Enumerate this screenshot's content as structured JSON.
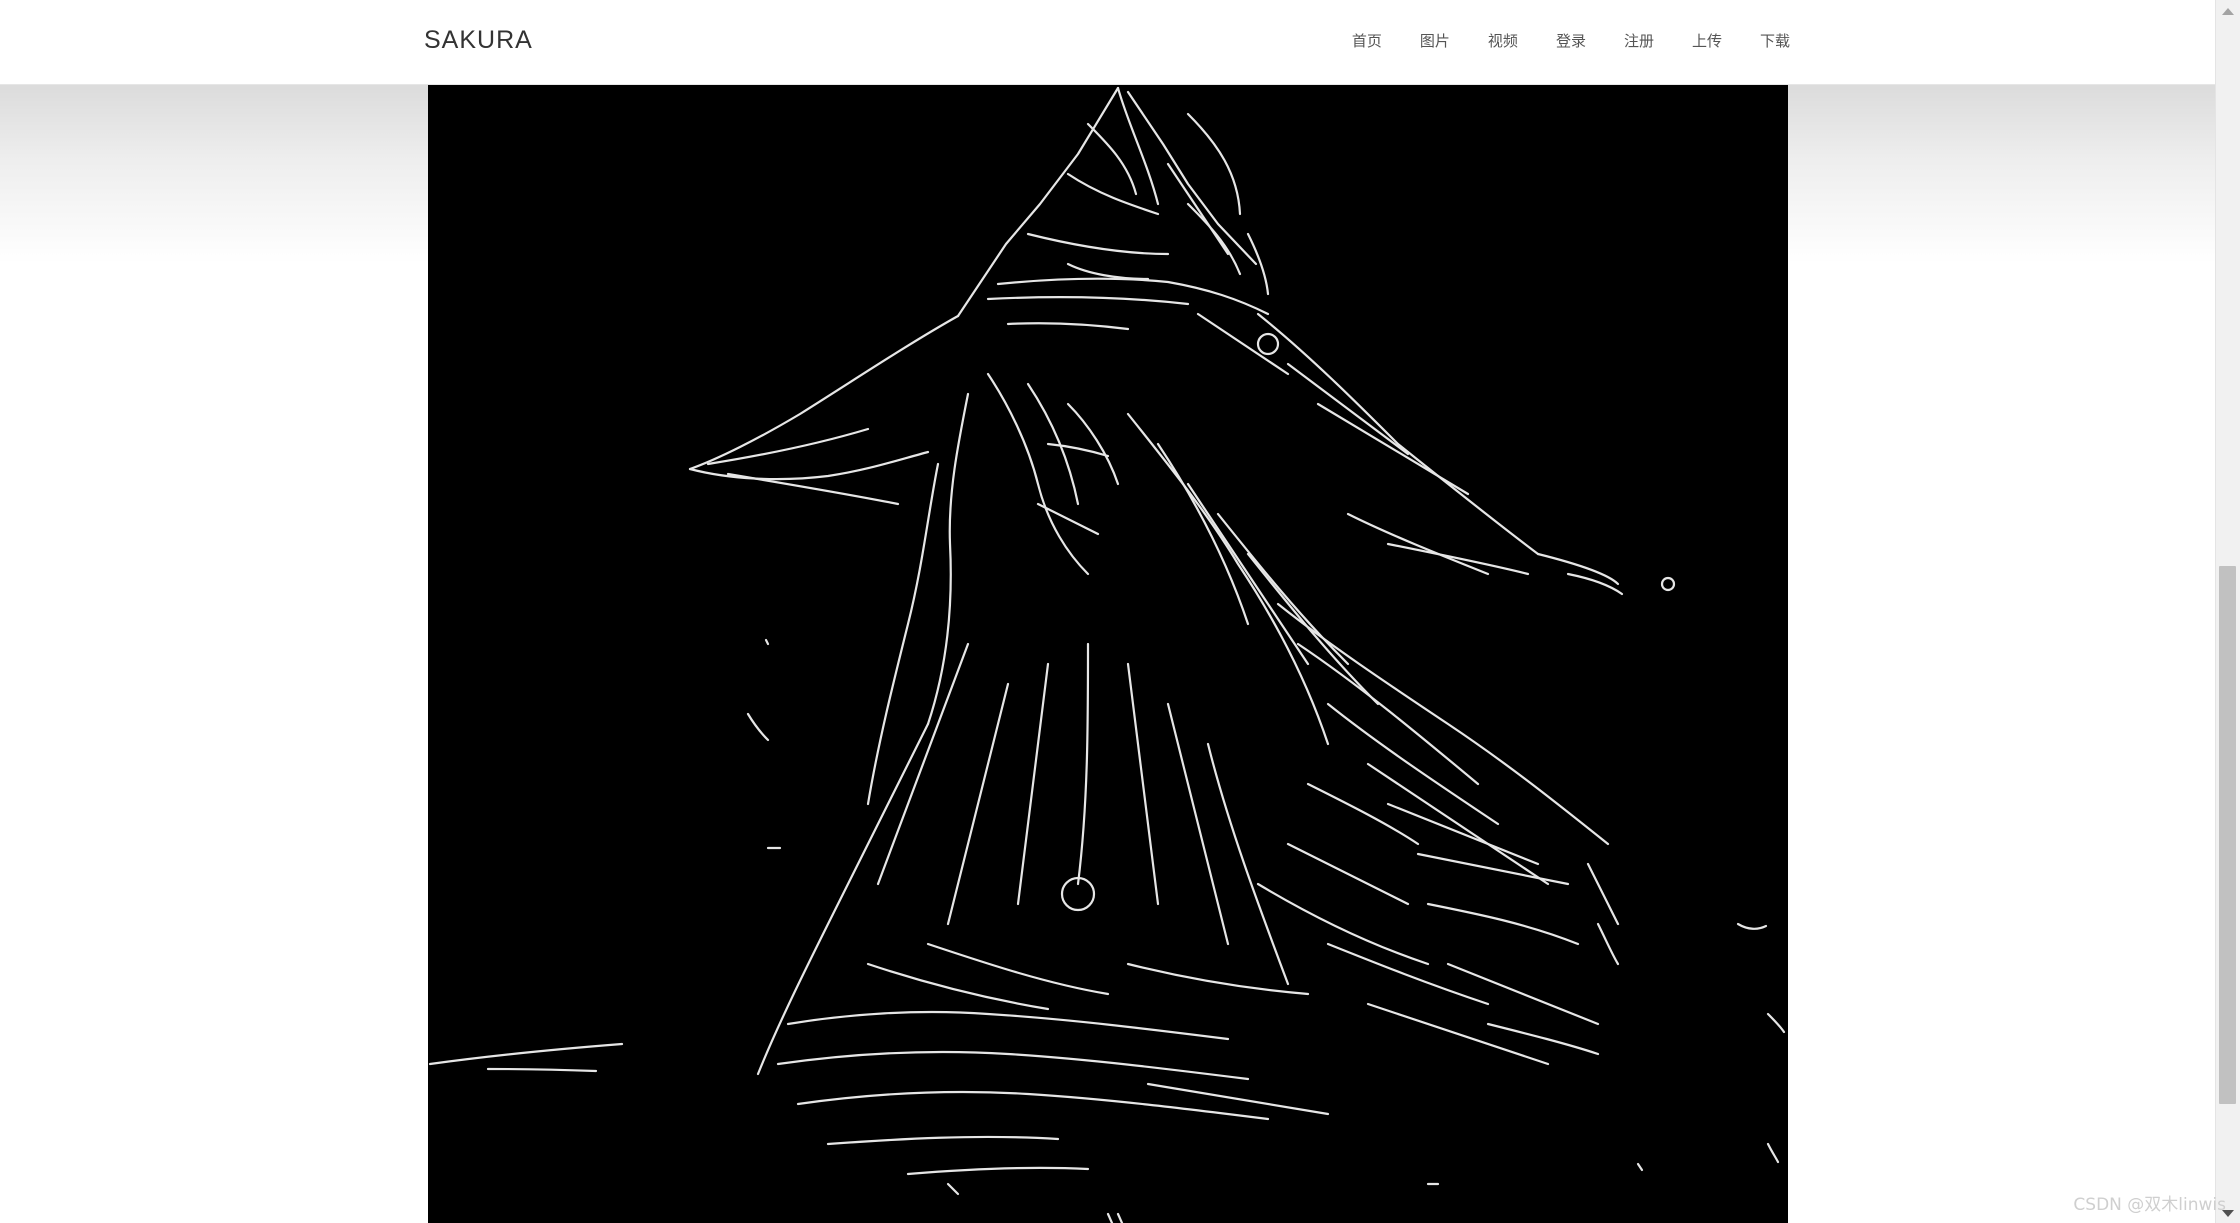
{
  "navbar": {
    "brand": "SAKURA",
    "items": [
      {
        "label": "首页"
      },
      {
        "label": "图片"
      },
      {
        "label": "视频"
      },
      {
        "label": "登录"
      },
      {
        "label": "注册"
      },
      {
        "label": "上传"
      },
      {
        "label": "下载"
      }
    ]
  },
  "image": {
    "background_color": "#000000",
    "stroke_color": "#e6e6e6"
  },
  "watermark": "CSDN @双木linwis"
}
